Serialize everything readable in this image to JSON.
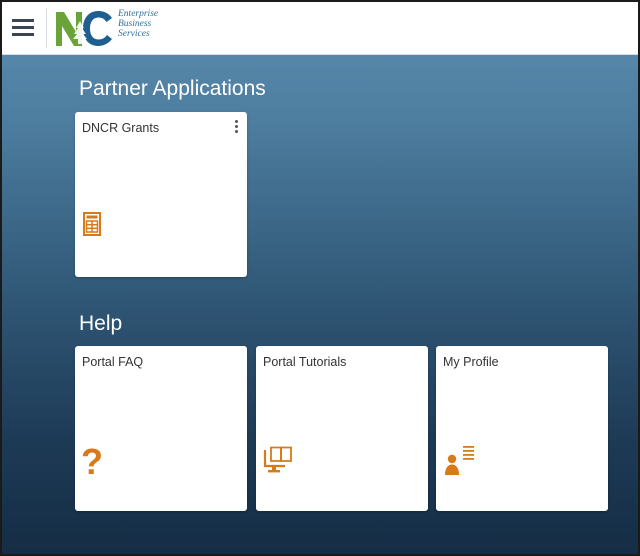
{
  "header": {
    "menu_icon": "hamburger-menu-icon",
    "logo": {
      "letters": "NC",
      "line1": "Enterprise",
      "line2": "Business",
      "line3": "Services"
    }
  },
  "sections": [
    {
      "title": "Partner Applications",
      "tiles": [
        {
          "label": "DNCR Grants",
          "icon": "calculator-icon",
          "has_menu": true
        }
      ]
    },
    {
      "title": "Help",
      "tiles": [
        {
          "label": "Portal FAQ",
          "icon": "question-mark-icon"
        },
        {
          "label": "Portal Tutorials",
          "icon": "monitor-book-icon"
        },
        {
          "label": "My Profile",
          "icon": "person-profile-icon"
        }
      ]
    }
  ],
  "colors": {
    "accent_icon": "#d87a17",
    "background_top": "#5c8fb2",
    "background_bottom": "#152d45",
    "tile": "#ffffff"
  }
}
